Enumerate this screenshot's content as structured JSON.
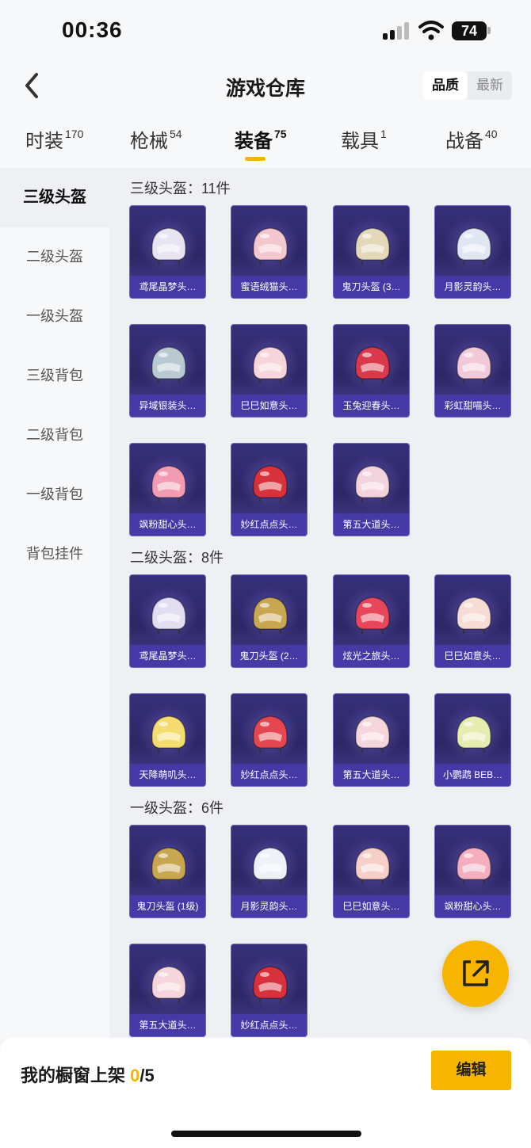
{
  "status_bar": {
    "time": "00:36",
    "battery": "74"
  },
  "header": {
    "title": "游戏仓库",
    "sort_options": [
      "品质",
      "最新"
    ]
  },
  "tabs": [
    {
      "label": "时装",
      "count": "170"
    },
    {
      "label": "枪械",
      "count": "54"
    },
    {
      "label": "装备",
      "count": "75"
    },
    {
      "label": "载具",
      "count": "1"
    },
    {
      "label": "战备",
      "count": "40"
    }
  ],
  "sidebar": [
    "三级头盔",
    "二级头盔",
    "一级头盔",
    "三级背包",
    "二级背包",
    "一级背包",
    "背包挂件"
  ],
  "sections": [
    {
      "title": "三级头盔：11件",
      "items": [
        "鸢尾晶梦头…",
        "蜜语绒猫头…",
        "鬼刀头盔 (3…",
        "月影灵韵头…",
        "异域银装头…",
        "巳巳如意头…",
        "玉兔迎春头…",
        "彩虹甜喵头…",
        "飒粉甜心头…",
        "妙红点点头…",
        "第五大道头…"
      ]
    },
    {
      "title": "二级头盔：8件",
      "items": [
        "鸢尾晶梦头…",
        "鬼刀头盔 (2…",
        "炫光之旅头…",
        "巳巳如意头…",
        "天降萌叽头…",
        "妙红点点头…",
        "第五大道头…",
        "小鹦鹉 BEB…"
      ]
    },
    {
      "title": "一级头盔：6件",
      "items": [
        "鬼刀头盔 (1级)",
        "月影灵韵头…",
        "巳巳如意头…",
        "飒粉甜心头…",
        "第五大道头…",
        "妙红点点头…"
      ]
    }
  ],
  "bottom": {
    "label": "我的橱窗上架",
    "count": "0",
    "total": "/5",
    "edit_label": "编辑"
  },
  "colors": {
    "accent": "#f7b500",
    "card_bg": "#2c2866",
    "card_label_bg": "#463aaa"
  }
}
